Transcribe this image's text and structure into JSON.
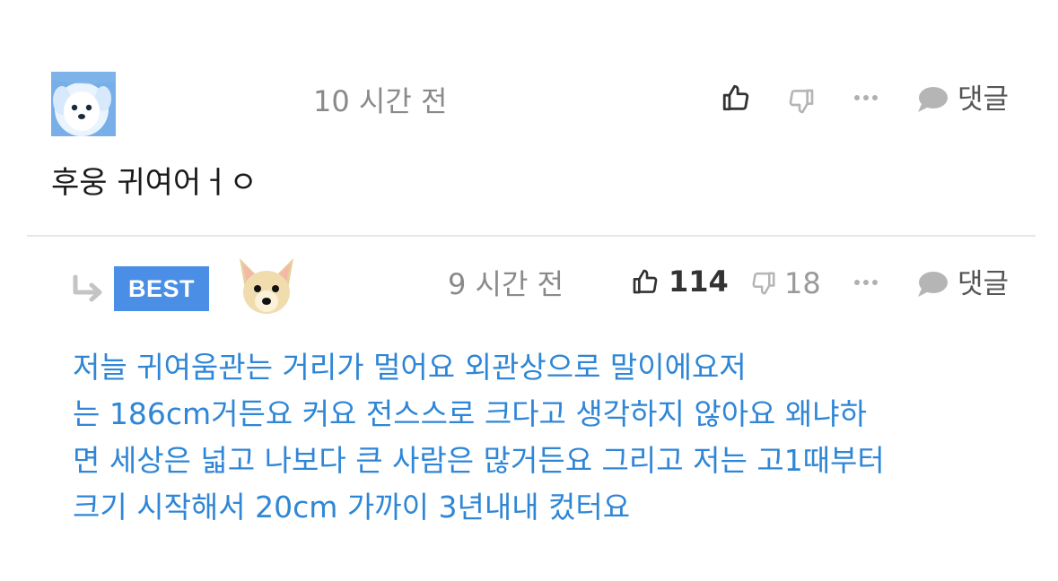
{
  "comment": {
    "avatar_icon": "white-dog-avatar-icon",
    "time": "10 시간 전",
    "actions": {
      "like_icon": "thumbs-up-icon",
      "dislike_icon": "thumbs-down-icon",
      "more_icon": "more-dots-icon",
      "reply_icon": "speech-bubble-icon",
      "reply_label": "댓글"
    },
    "text": "후웅 귀여어ㅓㅇ"
  },
  "reply": {
    "arrow_icon": "reply-arrow-icon",
    "badge": "BEST",
    "avatar_icon": "chihuahua-avatar-icon",
    "time": "9 시간 전",
    "likes": "114",
    "dislikes": "18",
    "actions": {
      "like_icon": "thumbs-up-icon",
      "dislike_icon": "thumbs-down-icon",
      "more_icon": "more-dots-icon",
      "reply_icon": "speech-bubble-icon",
      "reply_label": "댓글"
    },
    "text_lines": [
      "저늘 귀여움관는 거리가 멀어요 외관상으로 말이에요저",
      "는 186cm거든요 커요 전스스로 크다고 생각하지 않아요 왜냐하",
      "면 세상은 넓고 나보다 큰 사람은 많거든요 그리고 저는 고1때부터",
      "크기 시작해서 20cm 가까이 3년내내 컸터요"
    ]
  },
  "colors": {
    "best_badge": "#4a8fe5",
    "reply_text": "#2f86d6",
    "muted": "#8a8a8a"
  }
}
